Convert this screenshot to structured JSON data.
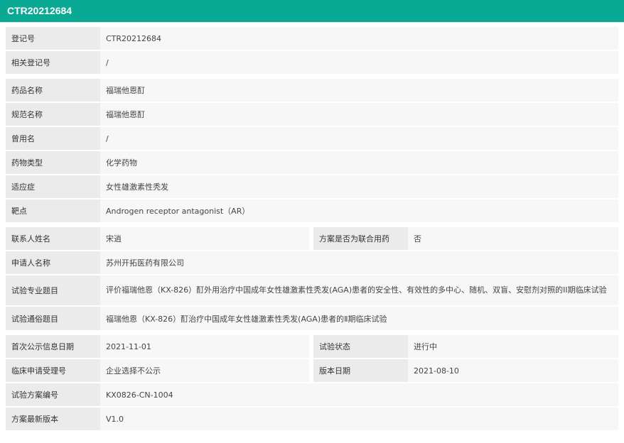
{
  "header": {
    "title": "CTR20212684"
  },
  "registration": {
    "reg_no_label": "登记号",
    "reg_no": "CTR20212684",
    "related_label": "相关登记号",
    "related": "/"
  },
  "drug": {
    "name_label": "药品名称",
    "name": "福瑞他恩酊",
    "std_name_label": "规范名称",
    "std_name": "福瑞他恩酊",
    "common_label": "曾用名",
    "common": "/",
    "type_label": "药物类型",
    "type": "化学药物",
    "indication_label": "适应症",
    "indication": "女性雄激素性秃发",
    "target_label": "靶点",
    "target": "Androgen receptor antagonist（AR）"
  },
  "trial": {
    "contact_label": "联系人姓名",
    "contact": "宋逍",
    "combo_label": "方案是否为联合用药",
    "combo": "否",
    "applicant_label": "申请人名称",
    "applicant": "苏州开拓医药有限公司",
    "title_label": "试验专业题目",
    "title": "评价福瑞他恩（KX-826）酊外用治疗中国成年女性雄激素性秃发(AGA)患者的安全性、有效性的多中心、随机、双盲、安慰剂对照的II期临床试验",
    "popular_label": "试验通俗题目",
    "popular": "福瑞他恩（KX-826）酊治疗中国成年女性雄激素性秃发(AGA)患者的Ⅱ期临床试验"
  },
  "publication": {
    "first_date_label": "首次公示信息日期",
    "first_date": "2021-11-01",
    "status_label": "试验状态",
    "status": "进行中",
    "accept_no_label": "临床申请受理号",
    "accept_no": "企业选择不公示",
    "version_date_label": "版本日期",
    "version_date": "2021-08-10",
    "protocol_no_label": "试验方案编号",
    "protocol_no": "KX0826-CN-1004",
    "latest_ver_label": "方案最新版本",
    "latest_ver": "V1.0"
  }
}
